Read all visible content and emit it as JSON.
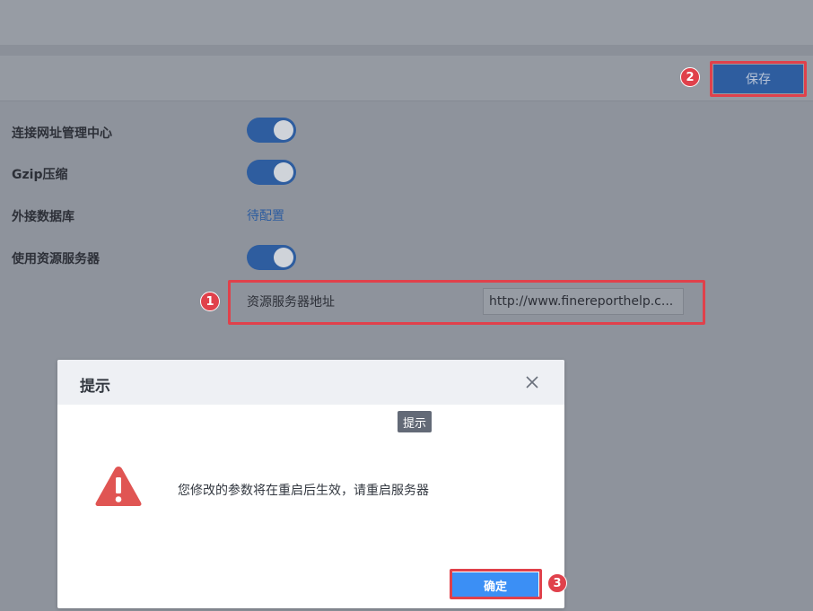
{
  "toolbar": {
    "save_label": "保存"
  },
  "settings": {
    "rows": [
      {
        "label": "连接网址管理中心",
        "type": "toggle",
        "on": true
      },
      {
        "label": "Gzip压缩",
        "type": "toggle",
        "on": true
      },
      {
        "label": "外接数据库",
        "type": "link",
        "value": "待配置"
      },
      {
        "label": "使用资源服务器",
        "type": "toggle",
        "on": true
      }
    ],
    "resource_server": {
      "label": "资源服务器地址",
      "value": "http://www.finereporthelp.c..."
    }
  },
  "annotations": {
    "step1": "1",
    "step2": "2",
    "step3": "3"
  },
  "dialog": {
    "title": "提示",
    "tooltip": "提示",
    "message": "您修改的参数将在重启后生效，请重启服务器",
    "ok_label": "确定"
  },
  "colors": {
    "primary": "#2e5d9f",
    "ok_button": "#3b8ff5",
    "highlight": "#e0414b",
    "warning": "#e05553"
  }
}
